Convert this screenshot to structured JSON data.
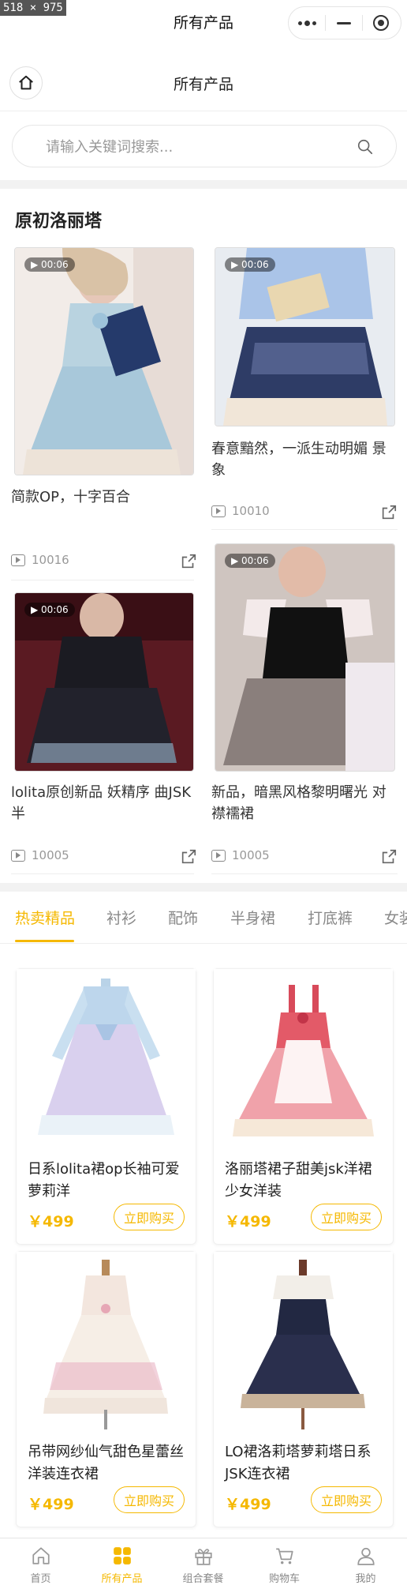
{
  "screenshot_badge": "518 × 975",
  "status_bar": {
    "title": "所有产品"
  },
  "navbar": {
    "title": "所有产品",
    "home_icon": "home-icon"
  },
  "search": {
    "placeholder": "请输入关键词搜索...",
    "icon": "search-icon"
  },
  "section": {
    "title": "原初洛丽塔"
  },
  "videos": [
    {
      "duration": "00:06",
      "title": "简款OP，十字百合",
      "views": "10016"
    },
    {
      "duration": "00:06",
      "title": "春意黯然，一派生动明媚 景象",
      "views": "10010"
    },
    {
      "duration": "00:06",
      "title": "lolita原创新品 妖精序 曲JSK半",
      "views": "10005"
    },
    {
      "duration": "00:06",
      "title": "新品，暗黑风格黎明曙光 对襟襦裙",
      "views": "10005"
    }
  ],
  "category_tabs": [
    "热卖精品",
    "衬衫",
    "配饰",
    "半身裙",
    "打底裤",
    "女装"
  ],
  "active_tab": "热卖精品",
  "products": [
    {
      "name": "日系lolita裙op长袖可爱萝莉洋",
      "price": "￥499",
      "buy_label": "立即购买"
    },
    {
      "name": "洛丽塔裙子甜美jsk洋裙少女洋装",
      "price": "￥499",
      "buy_label": "立即购买"
    },
    {
      "name": "吊带网纱仙气甜色星蕾丝洋装连衣裙",
      "price": "￥499",
      "buy_label": "立即购买"
    },
    {
      "name": "LO裙洛莉塔萝莉塔日系JSK连衣裙",
      "price": "￥499",
      "buy_label": "立即购买"
    }
  ],
  "tabbar": [
    {
      "label": "首页",
      "icon": "home-icon"
    },
    {
      "label": "所有产品",
      "icon": "grid-icon"
    },
    {
      "label": "组合套餐",
      "icon": "gift-icon"
    },
    {
      "label": "购物车",
      "icon": "cart-icon"
    },
    {
      "label": "我的",
      "icon": "user-icon"
    }
  ],
  "colors": {
    "accent": "#f5b800",
    "text": "#333333",
    "muted": "#999999",
    "divider": "#f2f2f2"
  }
}
